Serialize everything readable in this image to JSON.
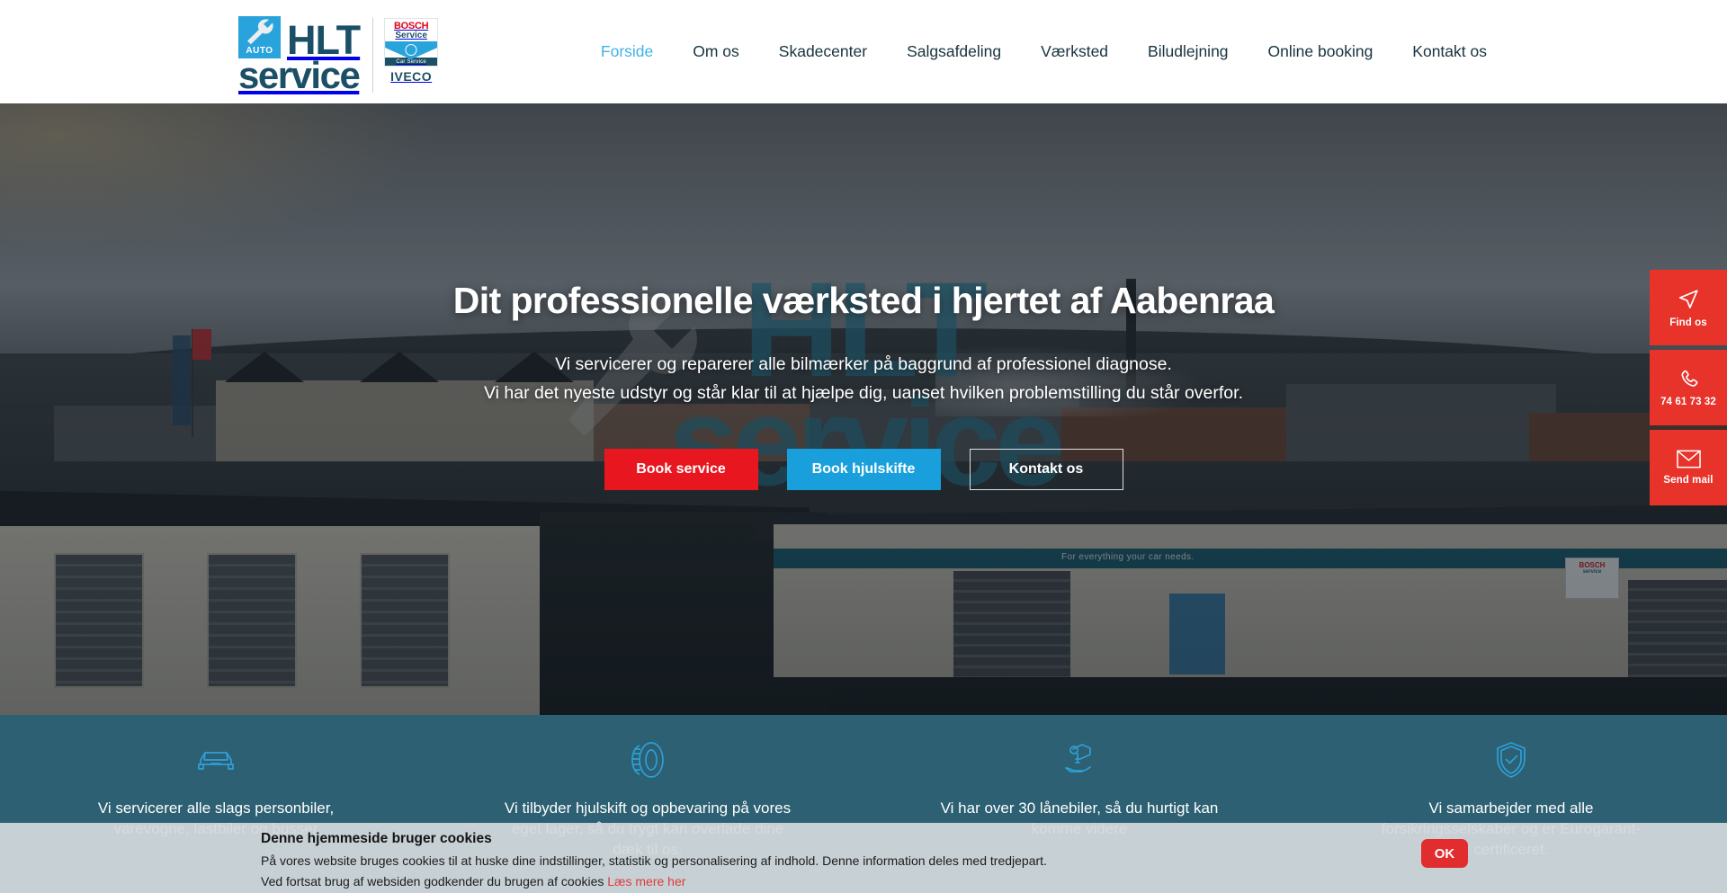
{
  "header": {
    "logo": {
      "badge_text": "AUTO",
      "brand_top": "HLT",
      "brand_bottom": "service",
      "partner_bosch_top": "BOSCH",
      "partner_bosch_mid": "Service",
      "partner_bosch_bottom": "Car Service",
      "partner_iveco": "IVECO"
    },
    "nav": [
      {
        "label": "Forside",
        "active": true
      },
      {
        "label": "Om os",
        "active": false
      },
      {
        "label": "Skadecenter",
        "active": false
      },
      {
        "label": "Salgsafdeling",
        "active": false
      },
      {
        "label": "Værksted",
        "active": false
      },
      {
        "label": "Biludlejning",
        "active": false
      },
      {
        "label": "Online booking",
        "active": false
      },
      {
        "label": "Kontakt os",
        "active": false
      }
    ]
  },
  "hero": {
    "watermark_top": "HLT",
    "watermark_bottom": "service",
    "signage_text": "For everything your car needs.",
    "title": "Dit professionelle værksted i hjertet af Aabenraa",
    "subtitle_line1": "Vi servicerer og reparerer alle bilmærker på baggrund af professionel diagnose.",
    "subtitle_line2": "Vi har det nyeste udstyr og står klar til at hjælpe dig, uanset hvilken problemstilling du står overfor.",
    "buttons": [
      {
        "label": "Book service",
        "style": "red"
      },
      {
        "label": "Book hjulskifte",
        "style": "blue"
      },
      {
        "label": "Kontakt os",
        "style": "outline"
      }
    ]
  },
  "rail": [
    {
      "icon": "location-arrow-icon",
      "label": "Find os"
    },
    {
      "icon": "phone-icon",
      "label": "74 61 73 32"
    },
    {
      "icon": "mail-icon",
      "label": "Send mail"
    }
  ],
  "features": [
    {
      "icon": "car-icon",
      "text": "Vi servicerer alle slags personbiler, varevogne, lastbiler og busser"
    },
    {
      "icon": "tire-icon",
      "text": "Vi tilbyder hjulskift og opbevaring på vores eget lager, så du trygt kan overlade dine dæk til os."
    },
    {
      "icon": "key-hand-icon",
      "text": "Vi har over 30 lånebiler, så du hurtigt kan komme videre"
    },
    {
      "icon": "shield-check-icon",
      "text": "Vi samarbejder med alle forsikringsselskaber og er Eurogarant-certificeret."
    }
  ],
  "cookie": {
    "title": "Denne hjemmeside bruger cookies",
    "line1": "På vores website bruges cookies til at huske dine indstillinger, statistik og personalisering af indhold. Denne information deles med tredjepart.",
    "line2_prefix": "Ved fortsat brug af websiden godkender du brugen af cookies ",
    "link": "Læs mere her",
    "ok_label": "OK"
  },
  "colors": {
    "brand_dark": "#1b4f66",
    "brand_blue": "#29a3dc",
    "accent_red": "#e8161f",
    "nav_active": "#43b3e6",
    "features_bg": "#0f4a5f"
  }
}
